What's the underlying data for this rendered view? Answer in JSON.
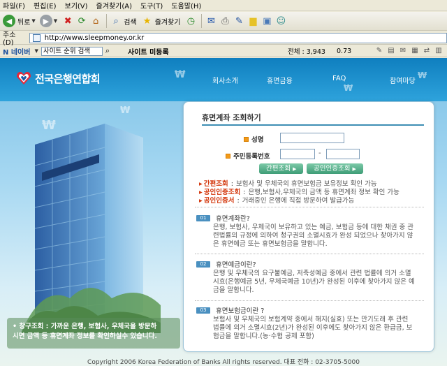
{
  "browser": {
    "menu": [
      "파일(F)",
      "편집(E)",
      "보기(V)",
      "즐겨찾기(A)",
      "도구(T)",
      "도움말(H)"
    ],
    "toolbar": {
      "back_label": "뒤로",
      "search_label": "검색",
      "favorites_label": "즐겨찾기"
    },
    "address": {
      "label": "주소(D)",
      "url": "http://www.sleepmoney.or.kr"
    },
    "navbar": {
      "logo": "N 네이버",
      "search_value": "사이트 순위 검색",
      "site_register": "사이트 미등록",
      "total": "전체 : 3,943",
      "rate": "0.73"
    }
  },
  "site": {
    "brand": "전국은행연합회",
    "nav": [
      "회사소개",
      "휴면금융",
      "FAQ",
      "참여마당"
    ],
    "promo": {
      "line1": "• 창구조회 : 가까운 은행, 보험사, 우체국을 방문하",
      "line2": "시면 금액 등 휴면계좌 정보를 확인하실수 있습니다."
    },
    "panel": {
      "title": "휴면계좌 조회하기",
      "name_label": "성명",
      "id_label": "주민등록번호",
      "btn_simple": "간편조회",
      "btn_cert": "공인인증조회",
      "bullets": [
        {
          "key": "간편조회",
          "text": "보험사 및 우체국의 휴면보험금 보유정보 확인 가능"
        },
        {
          "key": "공인인증조회",
          "text": "은행,보험사,우체국의 금액 등 휴면계좌 정보 확인 가능"
        },
        {
          "key": "공인인증서",
          "text": "거래중인 은행에 직접 방문하여 발급가능"
        }
      ],
      "faq": [
        {
          "num": "01",
          "question": "휴면계좌란?",
          "lines": [
            "은행, 보험사, 우체국이 보유하고 있는 예금, 보험금 등에 대한 채권 중 관",
            "련법률의 규정에 의하여 청구권의 소멸시효가 완성 되었으나 찾아가지 않",
            "은 휴면예금 또는 휴면보험금을 말합니다."
          ]
        },
        {
          "num": "02",
          "question": "휴면예금이란?",
          "lines": [
            "은행 및 우체국의 요구불예금, 저축성예금 중에서 관련 법률에 의거 소멸",
            "시효(은행예금 5년, 우체국예금 10년)가 완성된 이후에 찾아가지 않은 예",
            "금을 말합니다."
          ]
        },
        {
          "num": "03",
          "question": "휴면보험금이란 ?",
          "lines": [
            "보험사 및 우체국의 보험계약 중에서 해지(실효) 또는 만기도래 후 관련",
            "법률에 의거 소멸시효(2년)가 완성된 이후에도 찾아가지 않은 환급금, 보",
            "험금을 말합니다.(농·수협 공제 포함)"
          ]
        }
      ]
    },
    "footer": "Copyright 2006 Korea Federation of Banks All rights reserved. 대표 전화 : 02-3705-5000"
  }
}
